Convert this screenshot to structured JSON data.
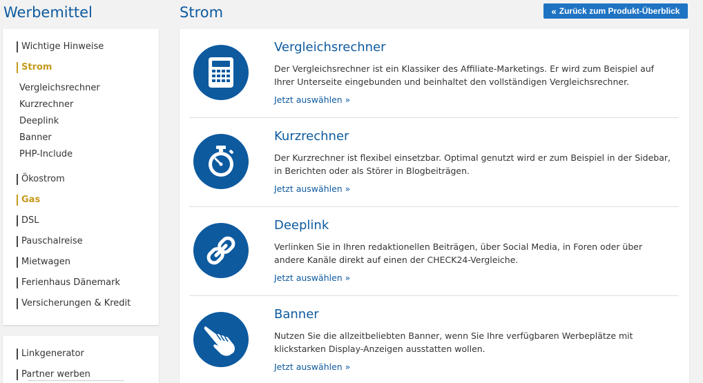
{
  "header": {
    "left_title": "Werbemittel",
    "main_title": "Strom",
    "back_button": "Zurück zum Produkt-Überblick"
  },
  "sidebar": {
    "items": [
      {
        "label": "Wichtige Hinweise"
      },
      {
        "label": "Strom"
      },
      {
        "label": "Vergleichsrechner"
      },
      {
        "label": "Kurzrechner"
      },
      {
        "label": "Deeplink"
      },
      {
        "label": "Banner"
      },
      {
        "label": "PHP-Include"
      },
      {
        "label": "Ökostrom"
      },
      {
        "label": "Gas"
      },
      {
        "label": "DSL"
      },
      {
        "label": "Pauschalreise"
      },
      {
        "label": "Mietwagen"
      },
      {
        "label": "Ferienhaus Dänemark"
      },
      {
        "label": "Versicherungen & Kredit"
      }
    ],
    "secondary": [
      {
        "label": "Linkgenerator"
      },
      {
        "label": "Partner werben"
      }
    ]
  },
  "cards": [
    {
      "title": "Vergleichsrechner",
      "desc": "Der Vergleichsrechner ist ein Klassiker des Affiliate-Marketings. Er wird zum Beispiel auf Ihrer Unterseite eingebunden und beinhaltet den vollständigen Vergleichsrechner.",
      "link": "Jetzt auswählen »",
      "icon": "calculator-icon"
    },
    {
      "title": "Kurzrechner",
      "desc": "Der Kurzrechner ist flexibel einsetzbar. Optimal genutzt wird er zum Beispiel in der Sidebar, in Berichten oder als Störer in Blogbeiträgen.",
      "link": "Jetzt auswählen »",
      "icon": "stopwatch-icon"
    },
    {
      "title": "Deeplink",
      "desc": "Verlinken Sie in Ihren redaktionellen Beiträgen, über Social Media, in Foren oder über andere Kanäle direkt auf einen der CHECK24-Vergleiche.",
      "link": "Jetzt auswählen »",
      "icon": "link-icon"
    },
    {
      "title": "Banner",
      "desc": "Nutzen Sie die allzeitbeliebten Banner, wenn Sie Ihre verfügbaren Werbeplätze mit klickstarken Display-Anzeigen ausstatten wollen.",
      "link": "Jetzt auswählen »",
      "icon": "pointing-hand-icon"
    }
  ],
  "colors": {
    "brand_blue": "#0d5a9f",
    "button_blue": "#1e73c3",
    "active_gold": "#c49a1d"
  }
}
